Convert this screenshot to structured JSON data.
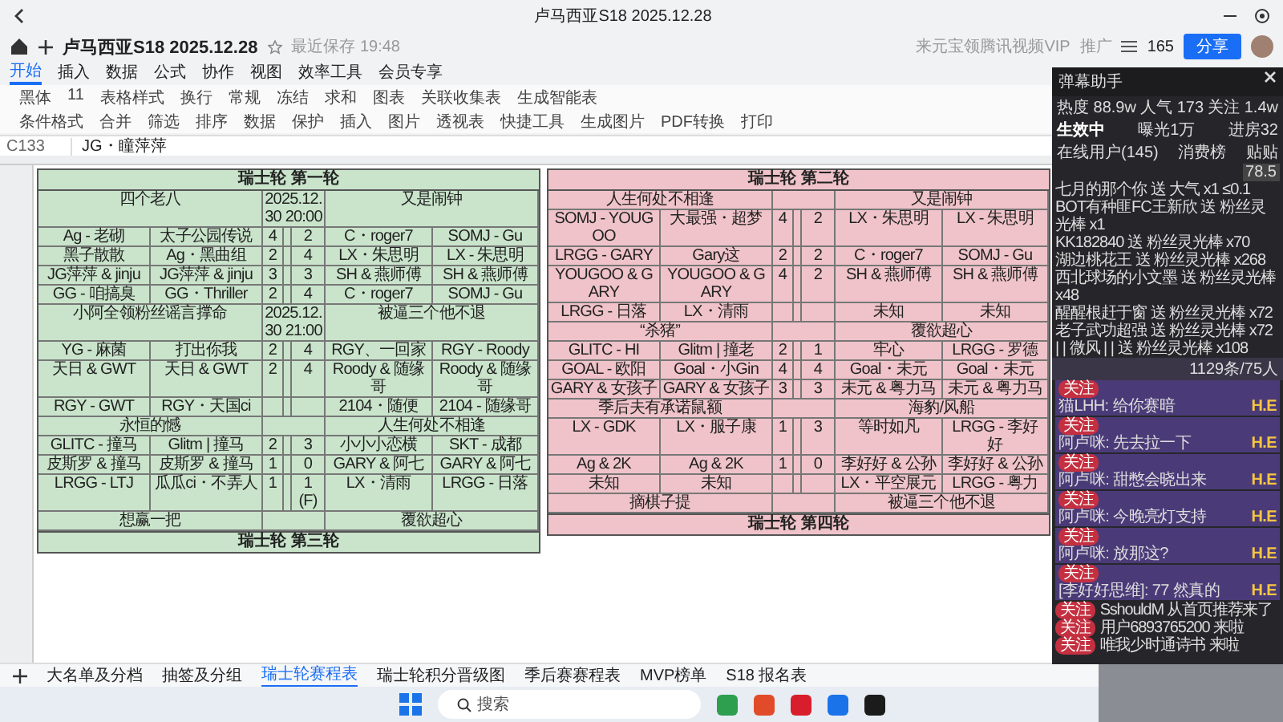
{
  "window": {
    "title": "卢马西亚S18 2025.12.28"
  },
  "doc": {
    "title": "卢马西亚S18 2025.12.28",
    "save_status": "最近保存 19:48",
    "promo": "来元宝领腾讯视频VIP",
    "promo_tag": "推广",
    "collaborators": "165",
    "share_button": "分享"
  },
  "menu": [
    {
      "label": "开始",
      "selected": true
    },
    {
      "label": "插入",
      "selected": false
    },
    {
      "label": "数据",
      "selected": false
    },
    {
      "label": "公式",
      "selected": false
    },
    {
      "label": "协作",
      "selected": false
    },
    {
      "label": "视图",
      "selected": false
    },
    {
      "label": "效率工具",
      "selected": false
    },
    {
      "label": "会员专享",
      "selected": false
    }
  ],
  "toolbar": {
    "row_1": [
      "黑体",
      "11",
      "表格样式",
      "换行",
      "常规",
      "冻结",
      "求和",
      "图表",
      "关联收集表",
      "生成智能表"
    ],
    "row_2": [
      "条件格式",
      "合并",
      "筛选",
      "排序",
      "数据",
      "保护",
      "插入",
      "图片",
      "透视表",
      "快捷工具",
      "生成图片",
      "PDF转换",
      "打印"
    ]
  },
  "formula_bar": {
    "cell": "C133",
    "value": "JG・瞳萍萍"
  },
  "sheet": {
    "tables": [
      {
        "title": "瑞士轮 第一轮",
        "color": "#c9e4cb",
        "next_title": "瑞士轮 第三轮",
        "blocks": [
          {
            "left": "四个老八",
            "date": "2025.12.30 20:00",
            "right": "又是闹钟",
            "rows": [
              {
                "left_1": "Ag - 老砌",
                "left_2": "太子公园传说",
                "score_1": "4",
                "score_2": "2",
                "right_1": "C・roger7",
                "right_2": "SOMJ - Gu"
              },
              {
                "left_1": "黑子散散",
                "left_2": "Ag・黑曲组",
                "score_1": "2",
                "score_2": "4",
                "right_1": "LX・朱思明",
                "right_2": "LX - 朱思明"
              },
              {
                "left_1": "JG萍萍 & jinju",
                "left_2": "JG萍萍 & jinju",
                "score_1": "3",
                "score_2": "3",
                "right_1": "SH & 燕师傅",
                "right_2": "SH & 燕师傅"
              },
              {
                "left_1": "GG - 咱搞臭",
                "left_2": "GG・Thriller",
                "score_1": "2",
                "score_2": "4",
                "right_1": "C・roger7",
                "right_2": "SOMJ - Gu"
              }
            ]
          },
          {
            "left": "小阿全领粉丝谣言撑命",
            "date": "2025.12.30 21:00",
            "right": "被逼三个他不退",
            "rows": [
              {
                "left_1": "YG - 麻菌",
                "left_2": "打出你我",
                "score_1": "2",
                "score_2": "4",
                "right_1": "RGY、一回家",
                "right_2": "RGY - Roody"
              },
              {
                "left_1": "天日 & GWT",
                "left_2": "天日 & GWT",
                "score_1": "2",
                "score_2": "4",
                "right_1": "Roody & 随缘哥",
                "right_2": "Roody & 随缘哥"
              },
              {
                "left_1": "RGY - GWT",
                "left_2": "RGY・天国ci",
                "right_1": "2104・随便",
                "right_2": "2104 - 随缘哥"
              }
            ]
          },
          {
            "left": "永恒的憾",
            "right": "人生何处不相逢",
            "rows": [
              {
                "left_1": "GLITC - 撞马",
                "left_2": "Glitm | 撞马",
                "score_1": "2",
                "score_2": "3",
                "right_1": "小小小恋横",
                "right_2": "SKT - 成都"
              },
              {
                "left_1": "皮斯罗 & 撞马",
                "left_2": "皮斯罗 & 撞马",
                "score_1": "1",
                "score_2": "0",
                "right_1": "GARY & 阿七",
                "right_2": "GARY & 阿七"
              },
              {
                "left_1": "LRGG - LTJ",
                "left_2": "瓜瓜ci・不弄人",
                "score_1": "1",
                "score_2": "1 (F)",
                "right_1": "LX・清雨",
                "right_2": "LRGG - 日落"
              }
            ]
          },
          {
            "left": "想赢一把",
            "right": "覆欲超心"
          }
        ]
      },
      {
        "title": "瑞士轮 第二轮",
        "color": "#efc3c9",
        "next_title": "瑞士轮 第四轮",
        "blocks": [
          {
            "left": "人生何处不相逢",
            "right": "又是闹钟",
            "rows": [
              {
                "left_1": "SOMJ - YOUGOO",
                "left_2": "大最强・超梦",
                "score_1": "4",
                "score_2": "2",
                "right_1": "LX・朱思明",
                "right_2": "LX - 朱思明"
              },
              {
                "left_1": "LRGG - GARY",
                "left_2": "Gary这",
                "score_1": "2",
                "score_2": "2",
                "right_1": "C・roger7",
                "right_2": "SOMJ - Gu"
              },
              {
                "left_1": "YOUGOO & GARY",
                "left_2": "YOUGOO & GARY",
                "score_1": "4",
                "score_2": "2",
                "right_1": "SH & 燕师傅",
                "right_2": "SH & 燕师傅"
              },
              {
                "left_1": "LRGG - 日落",
                "left_2": "LX・清雨",
                "right_1": "未知",
                "right_2": "未知"
              }
            ]
          },
          {
            "left": "“杀猪”",
            "right": "覆欲超心",
            "rows": [
              {
                "left_1": "GLITC - HI",
                "left_2": "Glitm | 撞老",
                "score_1": "2",
                "score_2": "1",
                "right_1": "牢心",
                "right_2": "LRGG - 罗德"
              },
              {
                "left_1": "GOAL - 欧阳",
                "left_2": "Goal・小Gin",
                "score_1": "4",
                "score_2": "4",
                "right_1": "Goal・未元",
                "right_2": "Goal・未元"
              },
              {
                "left_1": "GARY & 女孩子",
                "left_2": "GARY & 女孩子",
                "score_1": "3",
                "score_2": "3",
                "right_1": "未元 & 粤力马",
                "right_2": "未元 & 粤力马"
              }
            ]
          },
          {
            "left": "季后夫有承诺鼠额",
            "right": "海豹/风船",
            "rows": [
              {
                "left_1": "LX - GDK",
                "left_2": "LX・服子康",
                "score_1": "1",
                "score_2": "3",
                "right_1": "等时如凡",
                "right_2": "LRGG - 李好好"
              },
              {
                "left_1": "Ag & 2K",
                "left_2": "Ag & 2K",
                "score_1": "1",
                "score_2": "0",
                "right_1": "李好好 & 公孙",
                "right_2": "李好好 & 公孙"
              },
              {
                "left_1": "未知",
                "left_2": "未知",
                "right_1": "LX・平空展元",
                "right_2": "LRGG - 粤力"
              }
            ]
          },
          {
            "left": "摘棋子提",
            "right": "被逼三个他不退"
          }
        ]
      }
    ]
  },
  "sheet_tabs": [
    {
      "label": "大名单及分档",
      "selected": false
    },
    {
      "label": "抽签及分组",
      "selected": false
    },
    {
      "label": "瑞士轮赛程表",
      "selected": true
    },
    {
      "label": "瑞士轮积分晋级图",
      "selected": false
    },
    {
      "label": "季后赛赛程表",
      "selected": false
    },
    {
      "label": "MVP榜单",
      "selected": false
    },
    {
      "label": "S18 报名表",
      "selected": false
    }
  ],
  "taskbar": {
    "search_placeholder": "搜索"
  },
  "chat": {
    "title": "弹幕助手",
    "stats": [
      {
        "label": "热度",
        "value": "88.9w",
        "selected": false
      },
      {
        "label": "人气",
        "value": "173",
        "selected": false
      },
      {
        "label": "关注",
        "value": "1.4w",
        "selected": false
      }
    ],
    "stats_2": [
      {
        "label": "生效中",
        "selected": true
      },
      {
        "label": "曝光",
        "value": "1万",
        "selected": false
      },
      {
        "label": "进房",
        "value": "32",
        "selected": false
      }
    ],
    "tabs": [
      "在线用户(145)",
      "消费榜",
      "贴贴"
    ],
    "gifts_value": "78.5",
    "gifts": [
      {
        "user": "七月的那个你",
        "verb": "送",
        "gift": "大气",
        "count": "x1 ≤0.1"
      },
      {
        "user": "BOT有种匪FC王新欣",
        "verb": "送",
        "gift": "粉丝灵光棒",
        "count": "x1"
      },
      {
        "user": "KK182840",
        "verb": "送",
        "gift": "粉丝灵光棒",
        "count": "x70"
      },
      {
        "user": "湖边桃花王",
        "verb": "送",
        "gift": "粉丝灵光棒",
        "count": "x268"
      },
      {
        "user": "西北球场的小文墨",
        "verb": "送",
        "gift": "粉丝灵光棒",
        "count": "x48"
      },
      {
        "user": "醒醒根赶于窗",
        "verb": "送",
        "gift": "粉丝灵光棒",
        "count": "x72"
      },
      {
        "user": "老子武功超强",
        "verb": "送",
        "gift": "粉丝灵光棒",
        "count": "x72"
      },
      {
        "user": "| | 微风 | |",
        "verb": "送",
        "gift": "粉丝灵光棒",
        "count": "x108"
      }
    ],
    "message_count": "1129条/75人",
    "messages": [
      {
        "badge": "关注",
        "tag": "H.E",
        "text": "猫LHH: 给你赛暗"
      },
      {
        "badge": "关注",
        "tag": "H.E",
        "text": "阿卢咪: 先去拉一下"
      },
      {
        "badge": "关注",
        "tag": "H.E",
        "text": "阿卢咪: 甜憋会晓出来"
      },
      {
        "badge": "关注",
        "tag": "H.E",
        "text": "阿卢咪: 今晚亮灯支持"
      },
      {
        "badge": "关注",
        "tag": "H.E",
        "text": "阿卢咪: 放那这?"
      },
      {
        "badge": "关注",
        "tag": "H.E",
        "text": "[李好好思维]: 77 然真的"
      }
    ],
    "entries": [
      {
        "badge": "关注",
        "text": "SshouldM 从首页推荐来了"
      },
      {
        "badge": "关注",
        "text": "用户6893765200 来啦"
      },
      {
        "badge": "关注",
        "text": "唯我少时通诗书 来啦"
      }
    ]
  }
}
